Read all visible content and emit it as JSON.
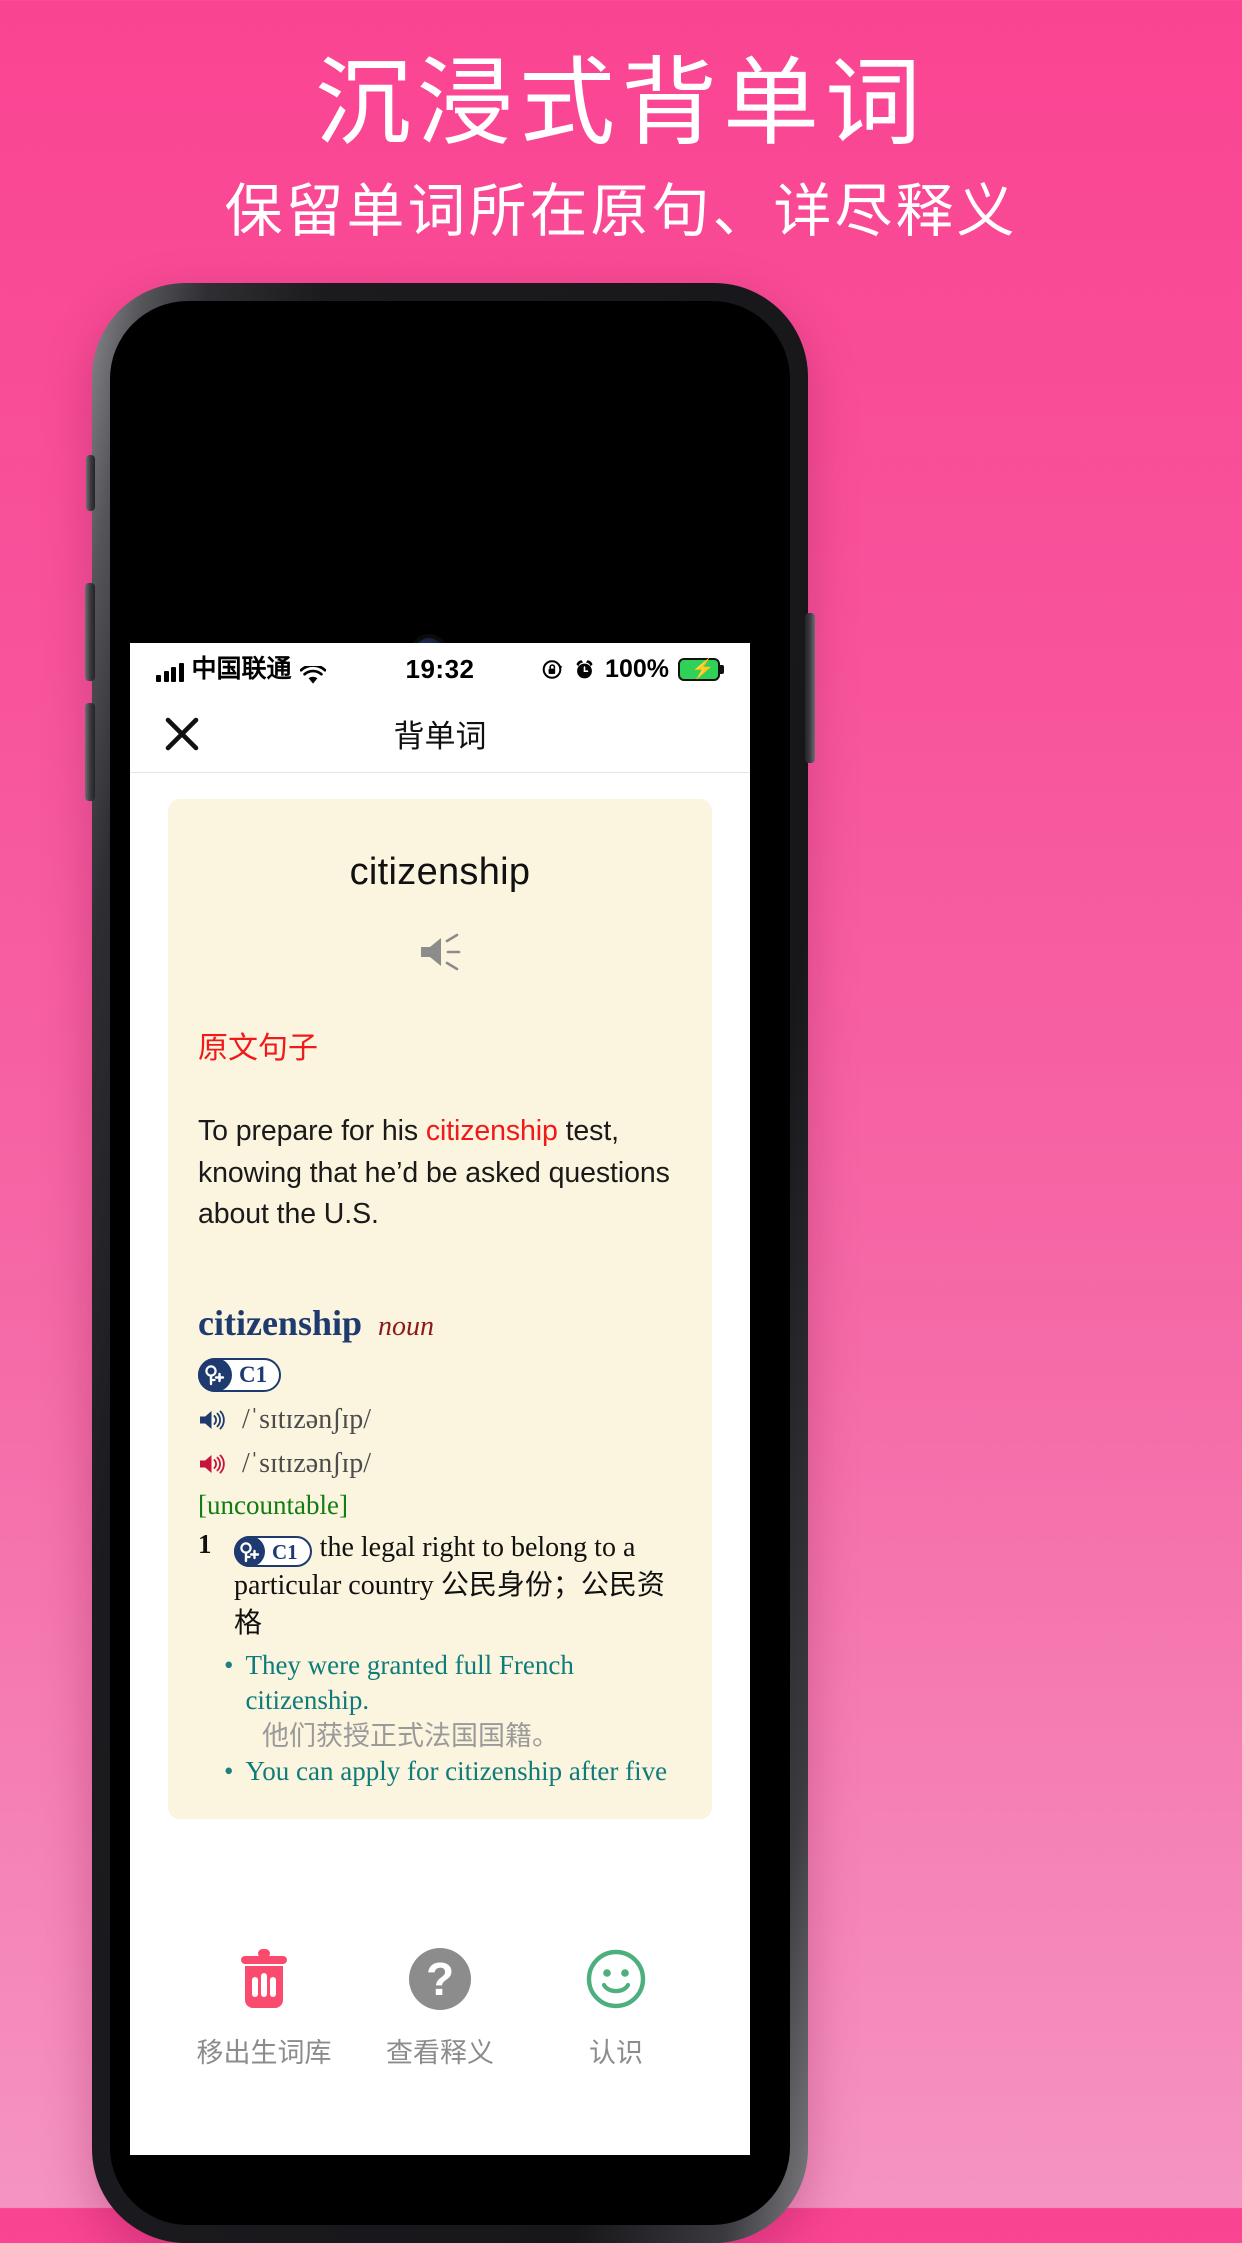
{
  "promo": {
    "title": "沉浸式背单词",
    "subtitle": "保留单词所在原句、详尽释义"
  },
  "colors": {
    "background_pink": "#FA4492",
    "card_cream": "#FBF4DE",
    "accent_red": "#F01A1A",
    "dict_navy": "#1E3A6E",
    "pos_darkred": "#8B1A1A",
    "gram_green": "#127C12",
    "example_teal": "#0E7C7B",
    "translation_gray": "#9A9A9A",
    "trash_pink": "#FA4B6E",
    "smiley_green": "#4CAF7D",
    "battery_green": "#30D158"
  },
  "status_bar": {
    "signal_icon": "signal-bars-icon",
    "carrier": "中国联通",
    "wifi_icon": "wifi-icon",
    "time": "19:32",
    "rotation_lock_icon": "rotation-lock-icon",
    "alarm_icon": "alarm-clock-icon",
    "battery_percent": "100%",
    "battery_icon": "battery-charging-icon"
  },
  "navbar": {
    "close_icon": "close-icon",
    "title": "背单词"
  },
  "card": {
    "headword": "citizenship",
    "speaker_icon": "speaker-icon",
    "source_label": "原文句子",
    "sentence": {
      "before": "To prepare for his ",
      "highlight": "citizenship",
      "after": " test, knowing that he’d be asked questions about the U.S."
    },
    "dictionary": {
      "headword": "citizenship",
      "part_of_speech": "noun",
      "cefr_level": "C1",
      "key_icon": "key-plus-icon",
      "pronunciations": [
        {
          "accent": "uk",
          "speaker_icon": "speaker-uk-icon",
          "ipa": "/ˈsɪtɪzənʃɪp/"
        },
        {
          "accent": "us",
          "speaker_icon": "speaker-us-icon",
          "ipa": "/ˈsɪtɪzənʃɪp/"
        }
      ],
      "grammar_note": "[uncountable]",
      "senses": [
        {
          "number": "1",
          "cefr_level": "C1",
          "definition_en": "the legal right to belong to a particular country",
          "definition_zh": "公民身份；公民资格",
          "examples": [
            {
              "bullet": "•",
              "en": "They were granted full French citizenship.",
              "zh": "他们获授正式法国国籍。"
            },
            {
              "bullet": "•",
              "en": "You can apply for citizenship after five",
              "zh": ""
            }
          ]
        }
      ]
    }
  },
  "toolbar": {
    "items": [
      {
        "icon": "trash-icon",
        "label": "移出生词库"
      },
      {
        "icon": "question-mark-icon",
        "label": "查看释义"
      },
      {
        "icon": "smiley-face-icon",
        "label": "认识"
      }
    ]
  }
}
